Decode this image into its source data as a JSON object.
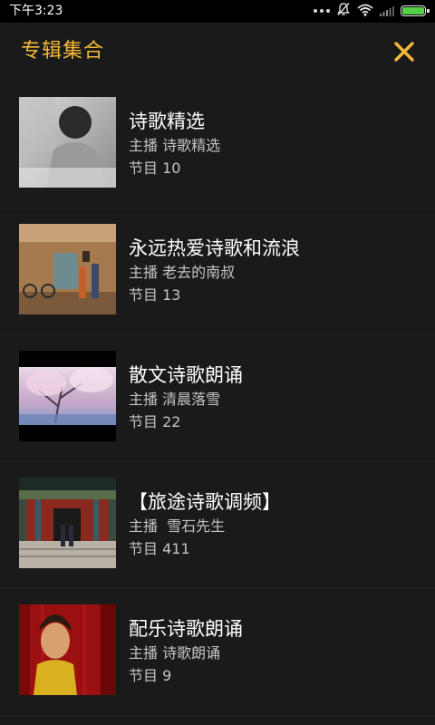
{
  "status_bar": {
    "time": "下午3:23",
    "icons": [
      "more-dots-icon",
      "mute-icon",
      "wifi-icon",
      "signal-icon",
      "battery-icon"
    ],
    "battery_color": "#55d046"
  },
  "header": {
    "title": "专辑集合",
    "title_color": "#f3b93b",
    "close_icon": "close-icon"
  },
  "albums": [
    {
      "title": "诗歌精选",
      "host": "主播 诗歌精选",
      "count": "节目 10"
    },
    {
      "title": "永远热爱诗歌和流浪",
      "host": "主播 老去的南叔",
      "count": "节目 13"
    },
    {
      "title": "散文诗歌朗诵",
      "host": "主播 清晨落雪",
      "count": "节目 22"
    },
    {
      "title": "【旅途诗歌调频】",
      "host": "主播  雪石先生",
      "count": "节目 411"
    },
    {
      "title": "配乐诗歌朗诵",
      "host": "主播 诗歌朗诵",
      "count": "节目 9"
    }
  ]
}
